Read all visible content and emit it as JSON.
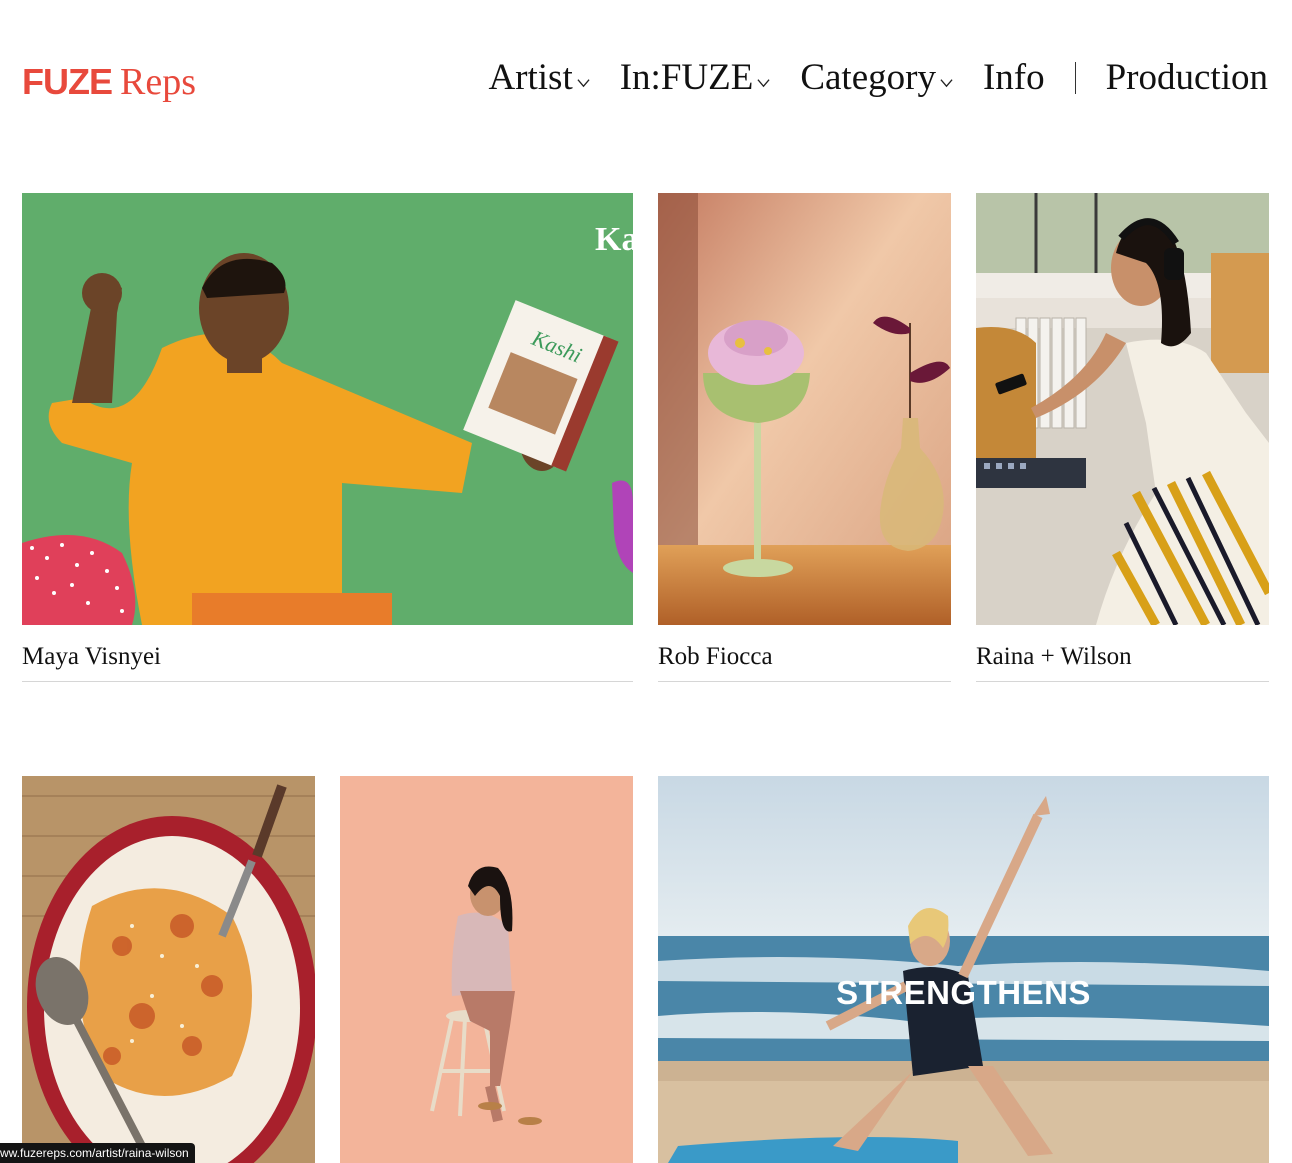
{
  "brand": {
    "mark": "FUZE",
    "word": "Reps",
    "color": "#e8493c"
  },
  "nav": {
    "items": [
      {
        "label": "Artist",
        "dropdown": true
      },
      {
        "label": "In:FUZE",
        "dropdown": true
      },
      {
        "label": "Category",
        "dropdown": true
      },
      {
        "label": "Info",
        "dropdown": false
      },
      {
        "label": "Production",
        "dropdown": false
      }
    ]
  },
  "portfolio": {
    "row1": [
      {
        "artist": "Maya Visnyei",
        "image": "man-dancing-with-cereal-box",
        "overlay": "Ka"
      },
      {
        "artist": "Rob Fiocca",
        "image": "cocktail-glass-with-flowers"
      },
      {
        "artist": "Raina + Wilson",
        "image": "woman-with-headphones-at-synth"
      }
    ],
    "row2": [
      {
        "image": "pappardelle-pasta-platter"
      },
      {
        "image": "woman-on-stool-peach-background"
      },
      {
        "image": "yoga-on-beach-video",
        "overlay": "STRENGTHENS"
      }
    ]
  },
  "status_bar": {
    "url": "ww.fuzereps.com/artist/raina-wilson"
  }
}
